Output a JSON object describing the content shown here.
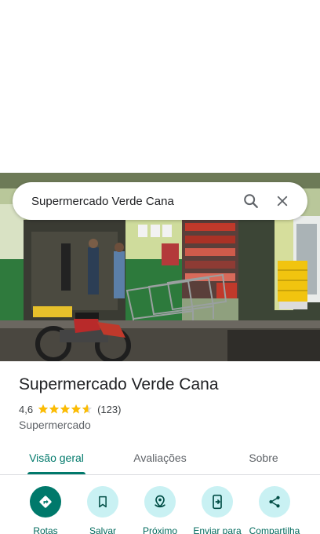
{
  "search": {
    "query": "Supermercado Verde Cana",
    "search_icon": "search-icon",
    "close_icon": "close-icon"
  },
  "place": {
    "name": "Supermercado Verde Cana",
    "rating": "4,6",
    "stars": 4.6,
    "review_count": "(123)",
    "category": "Supermercado"
  },
  "tabs": [
    {
      "label": "Visão geral",
      "active": true
    },
    {
      "label": "Avaliações",
      "active": false
    },
    {
      "label": "Sobre",
      "active": false
    }
  ],
  "actions": [
    {
      "label": "Rotas",
      "icon": "directions-icon"
    },
    {
      "label": "Salvar",
      "icon": "bookmark-icon"
    },
    {
      "label": "Próximo",
      "icon": "nearby-icon"
    },
    {
      "label": "Enviar para",
      "icon": "send-to-phone-icon"
    },
    {
      "label": "Compartilha",
      "icon": "share-icon"
    }
  ],
  "colors": {
    "accent": "#00796b",
    "action_bg": "#c9f1f3",
    "star": "#fbbc04"
  }
}
